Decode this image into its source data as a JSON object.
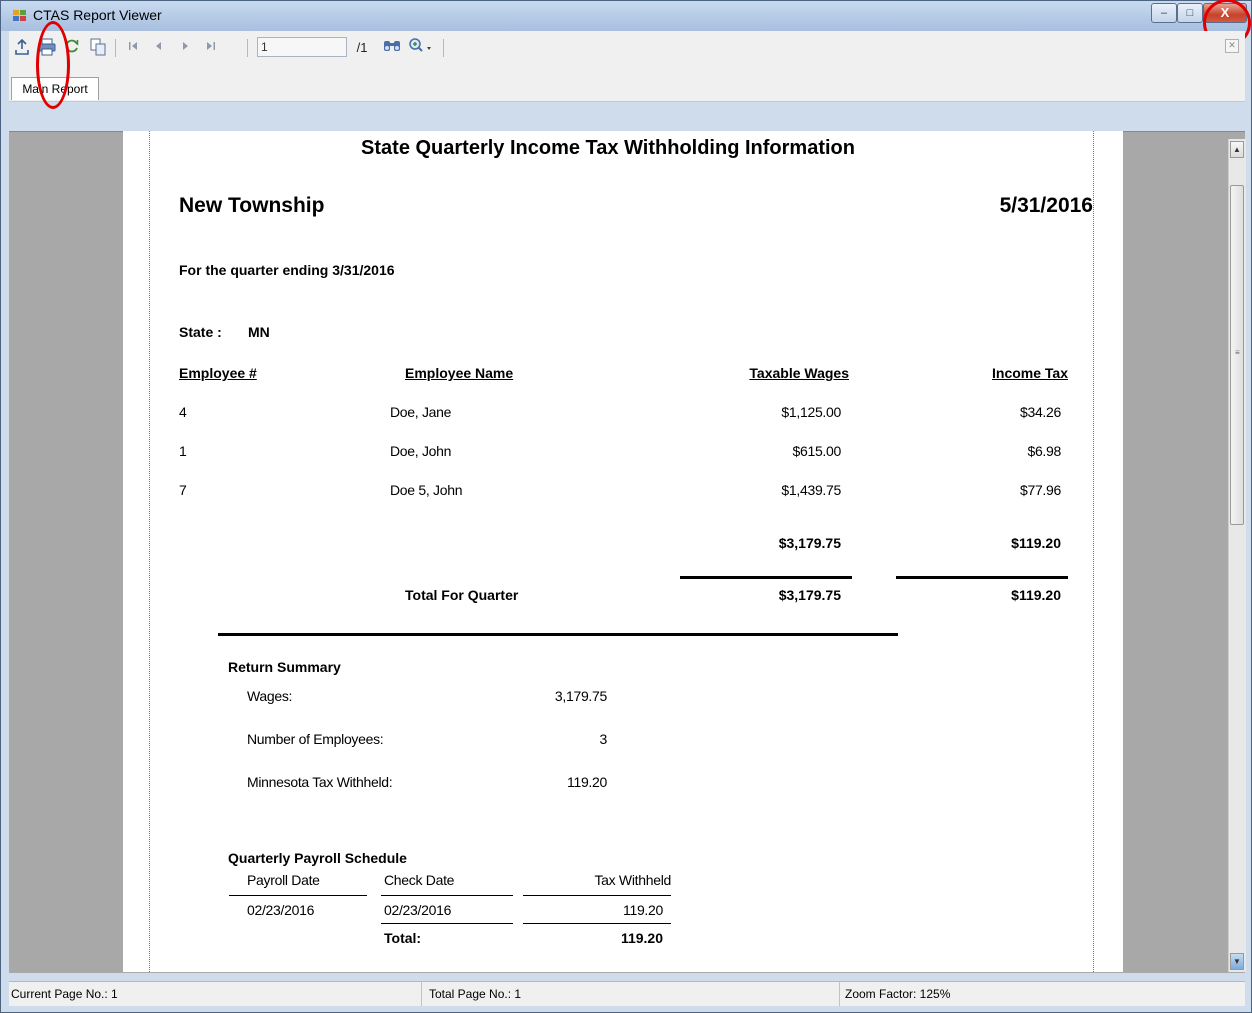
{
  "window": {
    "title": "CTAS Report Viewer",
    "buttons": {
      "minimize": "–",
      "maximize": "□",
      "close": "X"
    }
  },
  "toolbar": {
    "page_number_value": "1",
    "page_total": "/1",
    "tab_main_report": "Main Report",
    "icons": [
      "export-icon",
      "print-icon",
      "refresh-icon",
      "copy-icon",
      "first-page-icon",
      "previous-page-icon",
      "next-page-icon",
      "last-page-icon",
      "find-icon",
      "zoom-icon"
    ]
  },
  "report": {
    "title": "State Quarterly Income Tax Withholding Information",
    "entity": "New Township",
    "date": "5/31/2016",
    "quarter_label": "For the quarter ending 3/31/2016",
    "state_label": "State :",
    "state_value": "MN",
    "columns": {
      "employee_no": "Employee #",
      "employee_name": "Employee Name",
      "taxable_wages": "Taxable Wages",
      "income_tax": "Income Tax"
    },
    "rows": [
      {
        "employee_no": "4",
        "employee_name": "Doe, Jane",
        "taxable_wages": "$1,125.00",
        "income_tax": "$34.26"
      },
      {
        "employee_no": "1",
        "employee_name": "Doe, John",
        "taxable_wages": "$615.00",
        "income_tax": "$6.98"
      },
      {
        "employee_no": "7",
        "employee_name": "Doe 5, John",
        "taxable_wages": "$1,439.75",
        "income_tax": "$77.96"
      }
    ],
    "subtotal": {
      "taxable_wages": "$3,179.75",
      "income_tax": "$119.20"
    },
    "total_for_quarter": {
      "label": "Total For Quarter",
      "taxable_wages": "$3,179.75",
      "income_tax": "$119.20"
    },
    "return_summary": {
      "heading": "Return Summary",
      "wages_label": "Wages:",
      "wages_value": "3,179.75",
      "employees_label": "Number of Employees:",
      "employees_value": "3",
      "withheld_label": "Minnesota Tax Withheld:",
      "withheld_value": "119.20"
    },
    "payroll_schedule": {
      "heading": "Quarterly Payroll Schedule",
      "col_payroll_date": "Payroll Date",
      "col_check_date": "Check Date",
      "col_tax_withheld": "Tax Withheld",
      "rows": [
        {
          "payroll_date": "02/23/2016",
          "check_date": "02/23/2016",
          "tax_withheld": "119.20"
        }
      ],
      "total_label": "Total:",
      "total_value": "119.20"
    }
  },
  "status": {
    "current_page": "Current Page No.: 1",
    "total_page": "Total Page No.: 1",
    "zoom": "Zoom Factor: 125%"
  }
}
